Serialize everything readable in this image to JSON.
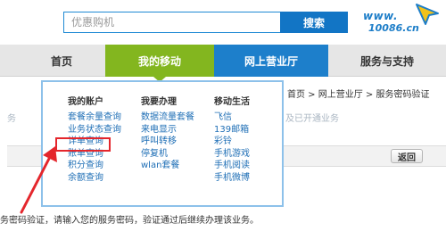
{
  "search": {
    "placeholder": "优惠购机",
    "button_label": "搜索"
  },
  "logo": {
    "line1": "www.",
    "line2": "10086.cn"
  },
  "nav": {
    "home": "首页",
    "mine": "我的移动",
    "hall": "网上营业厅",
    "service": "服务与支持"
  },
  "menu": {
    "columns": [
      {
        "heading": "我的账户",
        "items": [
          "套餐余量查询",
          "业务状态查询",
          "详单查询",
          "账单查询",
          "积分查询",
          "余额查询"
        ]
      },
      {
        "heading": "我要办理",
        "items": [
          "数据流量套餐",
          "来电显示",
          "呼叫转移",
          "停复机",
          "wlan套餐"
        ]
      },
      {
        "heading": "移动生活",
        "items": [
          "飞信",
          "139邮箱",
          "彩铃",
          "手机游戏",
          "手机阅读",
          "手机微博"
        ]
      }
    ]
  },
  "breadcrumb": "首页 >  网上营业厅 >  服务密码验证",
  "notice": "及已开通业务",
  "side_text": "务",
  "back_label": "返回",
  "instruction": "务密码验证，请输入您的服务密码，验证通过后继续办理该业务。",
  "colors": {
    "nav_green": "#83b61f",
    "nav_blue": "#1d7fcb",
    "link_blue": "#1f6fb6",
    "highlight_red": "#e4262c"
  }
}
